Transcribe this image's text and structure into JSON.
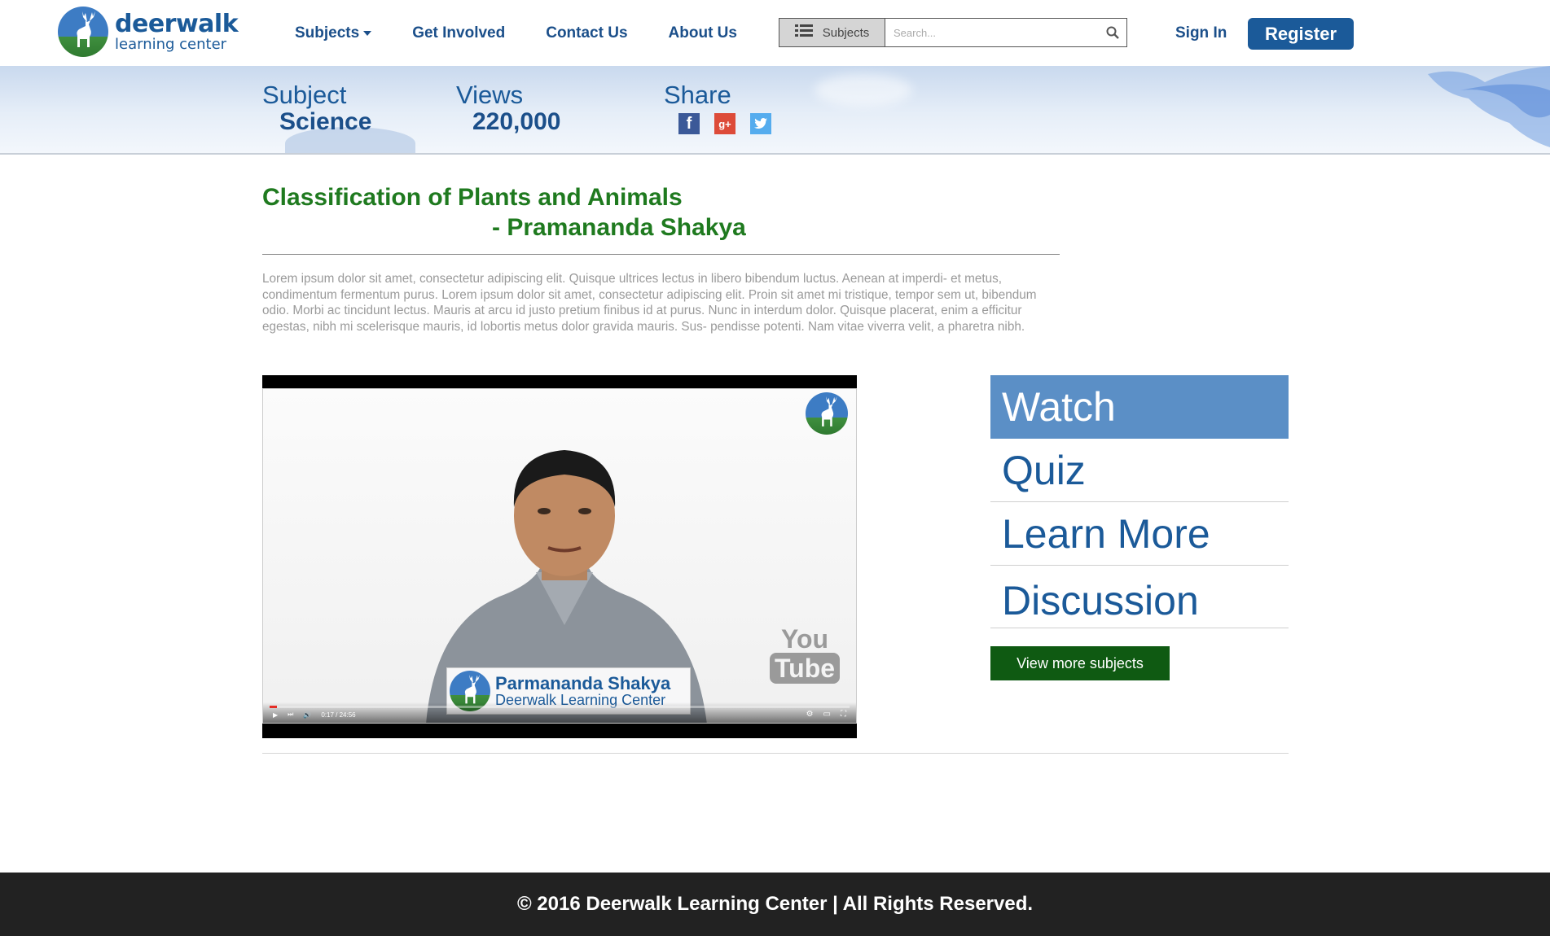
{
  "brand": {
    "name_line1": "deerwalk",
    "name_line2": "learning center",
    "color": "#1b5a99"
  },
  "nav": {
    "items": [
      {
        "label": "Subjects",
        "has_dropdown": true
      },
      {
        "label": "Get Involved"
      },
      {
        "label": "Contact Us"
      },
      {
        "label": "About Us"
      }
    ]
  },
  "search": {
    "category_label": "Subjects",
    "placeholder": "Search...",
    "value": ""
  },
  "auth": {
    "signin_label": "Sign In",
    "register_label": "Register"
  },
  "banner": {
    "subject_label": "Subject",
    "subject_value": "Science",
    "views_label": "Views",
    "views_value": "220,000",
    "share_label": "Share",
    "share_icons": [
      "facebook-icon",
      "google-plus-icon",
      "twitter-icon"
    ]
  },
  "lesson": {
    "title": "Classification of Plants and Animals",
    "author": "- Pramananda Shakya",
    "description": "Lorem ipsum dolor sit amet, consectetur adipiscing elit. Quisque ultrices lectus in libero bibendum luctus. Aenean at imperdi- et metus, condimentum fermentum purus. Lorem ipsum dolor sit amet, consectetur adipiscing elit. Proin sit amet mi tristique, tempor sem ut, bibendum odio. Morbi ac tincidunt lectus. Mauris at arcu id justo pretium finibus id at purus. Nunc in interdum dolor. Quisque placerat, enim a efficitur egestas, nibh mi scelerisque mauris, id lobortis metus dolor gravida mauris. Sus- pendisse potenti. Nam vitae viverra velit, a pharetra nibh."
  },
  "video": {
    "overlay_name": "Parmananda Shakya",
    "overlay_org": "Deerwalk Learning Center",
    "watermark_you": "You",
    "watermark_tube": "Tube",
    "time": "0:17 / 24:56",
    "progress_fraction": 0.012
  },
  "side_menu": {
    "items": [
      {
        "label": "Watch",
        "active": true
      },
      {
        "label": "Quiz"
      },
      {
        "label": "Learn More"
      },
      {
        "label": "Discussion"
      }
    ],
    "more_label": "View more subjects"
  },
  "footer": {
    "text": "© 2016 Deerwalk Learning Center | All Rights Reserved."
  },
  "colors": {
    "title_green": "#1f7a1f",
    "primary_blue": "#1b5a99",
    "active_tab": "#5b8fc6",
    "more_button": "#0f5a12",
    "footer_bg": "#222222"
  }
}
